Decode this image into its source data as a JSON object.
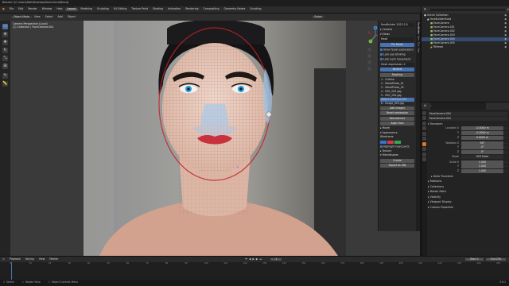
{
  "titlebar": {
    "title": "Blender* [C:\\Users\\Matt\\Desktop\\Maria.blend\\Blend]"
  },
  "menubar": {
    "menus": [
      "File",
      "Edit",
      "Render",
      "Window",
      "Help"
    ],
    "tabs": [
      "Layout",
      "Modeling",
      "Sculpting",
      "UV Editing",
      "Texture Paint",
      "Shading",
      "Animation",
      "Rendering",
      "Compositing",
      "Geometry Nodes",
      "Scripting"
    ],
    "active_tab": "Layout",
    "scene": "Scene",
    "view_layer": "ViewLayer"
  },
  "viewport_header": {
    "mode": "Object Mode",
    "menus": [
      "View",
      "Select",
      "Add",
      "Object"
    ],
    "shading": "Global"
  },
  "viewport": {
    "perspective_label": "Camera Perspective (Local)",
    "collection_path": "(1) Collection | FaceCamera.004",
    "photo_description": "",
    "gizmo_axes": {
      "x": "X",
      "y": "Y",
      "z": "Z"
    }
  },
  "sidepanel": {
    "tabs": [
      "FaceBuilder",
      "Item",
      "Tool",
      "View"
    ],
    "version": "FaceBuilder 2023.2.0",
    "sections": [
      "Camera",
      "Views"
    ],
    "head_label": "Head",
    "buttons": {
      "pin_mode": "Pin Mode",
      "show_facial": "Show facial expressions",
      "lock_view_blinking": "Lock eye blinking",
      "lock_neck": "Lock neck movement",
      "pins_count": "Head expression: 4",
      "neutral": "Neutral",
      "masking": "Masking",
      "add_images": "Add Images",
      "remove_images": "Remove Image",
      "create_texture": "Create Texture",
      "export": "Export",
      "reset_expression": "Reset expression",
      "reconstruct": "Reconstruct",
      "align_face": "Align Face",
      "take_snapshot": "Take snapshot",
      "create": "Create",
      "export_obj": "Export as OBJ"
    },
    "view_list": [
      "1 - Outline",
      "2 - MariaPhoto_01",
      "3 - MariaPhoto_02",
      "4 - DSC_001.jpg",
      "5 - DSC_002.jpg",
      "Select CamFace.004",
      "6 - Image_003.jpg"
    ],
    "model_header": "Model",
    "appearance_header": "Appearance",
    "wireframe_header": "Wireframe",
    "highlight_label": "Highlight head parts",
    "texture_header": "Texture",
    "blendshapes_header": "Blendshapes",
    "swatch_colors": [
      "#3a74c7",
      "#d23a4b",
      "#3aa74f"
    ],
    "accent": "#4772b3"
  },
  "outliner": {
    "title": "Scene Collection",
    "rows": [
      {
        "label": "Scene Collection",
        "sel": false
      },
      {
        "label": "FaceBuilderHead",
        "sel": false
      },
      {
        "label": "FaceCamera",
        "sel": false
      },
      {
        "label": "FaceCamera.001",
        "sel": false
      },
      {
        "label": "FaceCamera.002",
        "sel": false
      },
      {
        "label": "FaceCamera.003",
        "sel": false
      },
      {
        "label": "FaceCamera.004",
        "sel": true
      },
      {
        "label": "FaceCamera.005",
        "sel": false
      },
      {
        "label": "FBHead",
        "sel": false
      }
    ]
  },
  "properties": {
    "object_name": "FaceCamera.004",
    "data_name": "FaceCamera.004",
    "sections": [
      "Transform",
      "Delta Transform",
      "Relations",
      "Collections",
      "Motion Paths",
      "Visibility",
      "Viewport Display",
      "Custom Properties"
    ],
    "transform": {
      "location": [
        "-0.0000 m",
        "-0.0000 m",
        "0.0000 m"
      ],
      "rotation": [
        "90°",
        "-0°",
        "0°"
      ],
      "mode": "XYZ Euler",
      "scale": [
        "1.000",
        "1.000",
        "1.000"
      ],
      "labels": [
        "Location X",
        "Y",
        "Z",
        "Rotation X",
        "Y",
        "Z",
        "Mode",
        "Scale X",
        "Y",
        "Z"
      ]
    }
  },
  "timeline": {
    "menus": [
      "Playback",
      "Keying",
      "View",
      "Marker"
    ],
    "start": "Start 1",
    "end": "End 250",
    "current_frame": "1",
    "ticks": [
      "0",
      "10",
      "20",
      "30",
      "40",
      "50",
      "60",
      "70",
      "80",
      "90",
      "100",
      "110",
      "120",
      "130",
      "140",
      "150",
      "160",
      "170",
      "180",
      "190",
      "200",
      "210",
      "220",
      "230",
      "240",
      "250"
    ]
  },
  "statusbar": {
    "left": "Select",
    "middle": "Rotate View",
    "right_a": "Object Context Menu",
    "version": "3.6.1"
  }
}
